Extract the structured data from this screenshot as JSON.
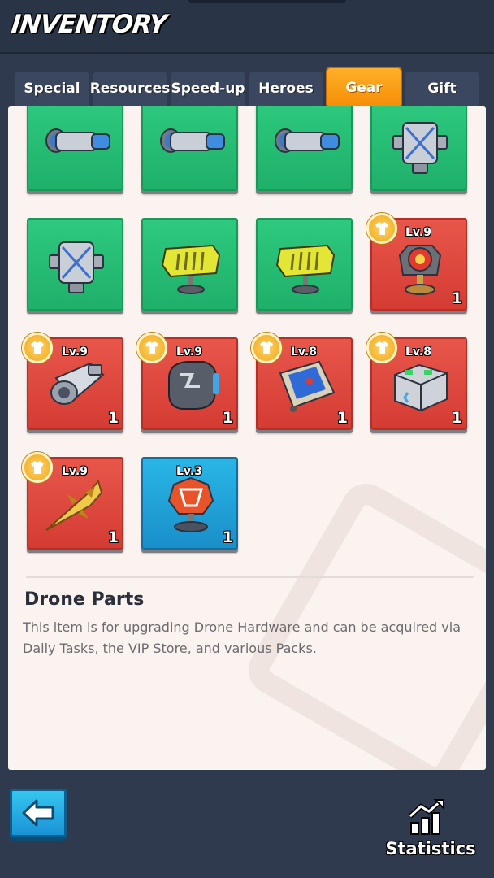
{
  "header": {
    "title": "INVENTORY"
  },
  "tabs": [
    {
      "label": "Special",
      "active": false
    },
    {
      "label": "Resources",
      "active": false
    },
    {
      "label": "Speed-up",
      "active": false
    },
    {
      "label": "Heroes",
      "active": false
    },
    {
      "label": "Gear",
      "active": true
    },
    {
      "label": "Gift",
      "active": false
    }
  ],
  "items": [
    {
      "icon": "binoculars-icon",
      "rarity": "green",
      "level": "",
      "qty": ""
    },
    {
      "icon": "binoculars-icon",
      "rarity": "green",
      "level": "",
      "qty": ""
    },
    {
      "icon": "binoculars-icon",
      "rarity": "green",
      "level": "",
      "qty": ""
    },
    {
      "icon": "drone-parts-icon",
      "rarity": "green",
      "level": "",
      "qty": ""
    },
    {
      "icon": "drone-parts-icon",
      "rarity": "green",
      "level": "",
      "qty": ""
    },
    {
      "icon": "yellow-part-icon",
      "rarity": "green",
      "level": "",
      "qty": ""
    },
    {
      "icon": "yellow-part-icon",
      "rarity": "green",
      "level": "",
      "qty": ""
    },
    {
      "icon": "radar-target-icon",
      "rarity": "red",
      "level": "Lv.9",
      "qty": "1"
    },
    {
      "icon": "engine-icon",
      "rarity": "red",
      "level": "Lv.9",
      "qty": "1"
    },
    {
      "icon": "armor-plate-icon",
      "rarity": "red",
      "level": "Lv.9",
      "qty": "1"
    },
    {
      "icon": "tablet-map-icon",
      "rarity": "red",
      "level": "Lv.8",
      "qty": "1"
    },
    {
      "icon": "server-box-icon",
      "rarity": "red",
      "level": "Lv.8",
      "qty": "1"
    },
    {
      "icon": "missile-icon",
      "rarity": "red",
      "level": "Lv.9",
      "qty": "1"
    },
    {
      "icon": "radar-dish-icon",
      "rarity": "blue",
      "level": "Lv.3",
      "qty": "1"
    }
  ],
  "description": {
    "title": "Drone Parts",
    "text": "This item is for upgrading Drone Hardware and can be acquired via Daily Tasks, the VIP Store, and various Packs."
  },
  "footer": {
    "back_icon": "arrow-left-icon",
    "statistics_label": "Statistics",
    "statistics_icon": "chart-up-icon"
  }
}
